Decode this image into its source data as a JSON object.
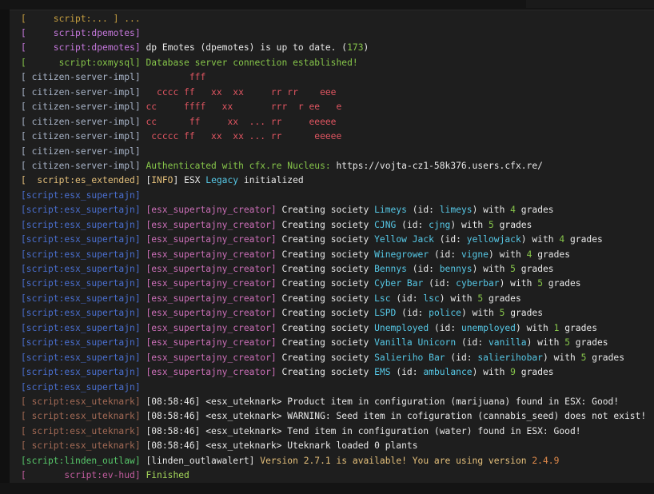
{
  "top_partial": "[     script:... ] ...",
  "colors": {
    "background": "#1e1e1e",
    "green": "#86c54a",
    "cyan": "#56c8e6",
    "red": "#e05561",
    "yellow": "#e5c07b",
    "blue": "#4a6fd0"
  },
  "lines": [
    {
      "segments": [
        {
          "t": "[     script:dpemotes]",
          "c": "c-pink"
        }
      ]
    },
    {
      "segments": [
        {
          "t": "[     script:dpemotes]",
          "c": "c-pink"
        },
        {
          "t": " dp Emotes (dpemotes) is up to date. (",
          "c": "c-white"
        },
        {
          "t": "173",
          "c": "c-green"
        },
        {
          "t": ")",
          "c": "c-white"
        }
      ]
    },
    {
      "segments": [
        {
          "t": "[      script:oxmysql]",
          "c": "c-green"
        },
        {
          "t": " Database server connection established!",
          "c": "c-green"
        }
      ]
    },
    {
      "segments": [
        {
          "t": "[ citizen-server-impl]",
          "c": "c-lightgray"
        },
        {
          "t": "         fff",
          "c": "c-red"
        }
      ]
    },
    {
      "segments": [
        {
          "t": "[ citizen-server-impl]",
          "c": "c-lightgray"
        },
        {
          "t": "   cccc ff   xx  xx     rr rr    eee",
          "c": "c-red"
        }
      ]
    },
    {
      "segments": [
        {
          "t": "[ citizen-server-impl]",
          "c": "c-lightgray"
        },
        {
          "t": " cc     ffff   xx       rrr  r ee   e",
          "c": "c-red"
        }
      ]
    },
    {
      "segments": [
        {
          "t": "[ citizen-server-impl]",
          "c": "c-lightgray"
        },
        {
          "t": " cc      ff     xx  ... rr     eeeee",
          "c": "c-red"
        }
      ]
    },
    {
      "segments": [
        {
          "t": "[ citizen-server-impl]",
          "c": "c-lightgray"
        },
        {
          "t": "  ccccc ff   xx  xx ... rr      eeeee",
          "c": "c-red"
        }
      ]
    },
    {
      "segments": [
        {
          "t": "[ citizen-server-impl]",
          "c": "c-lightgray"
        }
      ]
    },
    {
      "segments": [
        {
          "t": "[ citizen-server-impl]",
          "c": "c-lightgray"
        },
        {
          "t": " Authenticated with cfx.re Nucleus: ",
          "c": "c-green"
        },
        {
          "t": "https://vojta-cz1-58k376.users.cfx.re/",
          "c": "c-white"
        }
      ]
    },
    {
      "segments": [
        {
          "t": "[  script:es_extended]",
          "c": "c-yellow"
        },
        {
          "t": " [",
          "c": "c-white"
        },
        {
          "t": "INFO",
          "c": "c-yellow"
        },
        {
          "t": "] ESX ",
          "c": "c-white"
        },
        {
          "t": "Legacy",
          "c": "c-cyan"
        },
        {
          "t": " initialized",
          "c": "c-white"
        }
      ]
    },
    {
      "segments": [
        {
          "t": "[script:esx_supertajn]",
          "c": "c-blue"
        }
      ]
    },
    {
      "segments": [
        {
          "t": "[script:esx_supertajn]",
          "c": "c-blue"
        },
        {
          "t": " [esx_supertajny_creator]",
          "c": "c-magenta"
        },
        {
          "t": " Creating society ",
          "c": "c-white"
        },
        {
          "t": "Limeys",
          "c": "c-cyan"
        },
        {
          "t": " (id: ",
          "c": "c-white"
        },
        {
          "t": "limeys",
          "c": "c-cyan"
        },
        {
          "t": ") with ",
          "c": "c-white"
        },
        {
          "t": "4",
          "c": "c-green"
        },
        {
          "t": " grades",
          "c": "c-white"
        }
      ]
    },
    {
      "segments": [
        {
          "t": "[script:esx_supertajn]",
          "c": "c-blue"
        },
        {
          "t": " [esx_supertajny_creator]",
          "c": "c-magenta"
        },
        {
          "t": " Creating society ",
          "c": "c-white"
        },
        {
          "t": "CJNG",
          "c": "c-cyan"
        },
        {
          "t": " (id: ",
          "c": "c-white"
        },
        {
          "t": "cjng",
          "c": "c-cyan"
        },
        {
          "t": ") with ",
          "c": "c-white"
        },
        {
          "t": "5",
          "c": "c-green"
        },
        {
          "t": " grades",
          "c": "c-white"
        }
      ]
    },
    {
      "segments": [
        {
          "t": "[script:esx_supertajn]",
          "c": "c-blue"
        },
        {
          "t": " [esx_supertajny_creator]",
          "c": "c-magenta"
        },
        {
          "t": " Creating society ",
          "c": "c-white"
        },
        {
          "t": "Yellow Jack",
          "c": "c-cyan"
        },
        {
          "t": " (id: ",
          "c": "c-white"
        },
        {
          "t": "yellowjack",
          "c": "c-cyan"
        },
        {
          "t": ") with ",
          "c": "c-white"
        },
        {
          "t": "4",
          "c": "c-green"
        },
        {
          "t": " grades",
          "c": "c-white"
        }
      ]
    },
    {
      "segments": [
        {
          "t": "[script:esx_supertajn]",
          "c": "c-blue"
        },
        {
          "t": " [esx_supertajny_creator]",
          "c": "c-magenta"
        },
        {
          "t": " Creating society ",
          "c": "c-white"
        },
        {
          "t": "Winegrower",
          "c": "c-cyan"
        },
        {
          "t": " (id: ",
          "c": "c-white"
        },
        {
          "t": "vigne",
          "c": "c-cyan"
        },
        {
          "t": ") with ",
          "c": "c-white"
        },
        {
          "t": "4",
          "c": "c-green"
        },
        {
          "t": " grades",
          "c": "c-white"
        }
      ]
    },
    {
      "segments": [
        {
          "t": "[script:esx_supertajn]",
          "c": "c-blue"
        },
        {
          "t": " [esx_supertajny_creator]",
          "c": "c-magenta"
        },
        {
          "t": " Creating society ",
          "c": "c-white"
        },
        {
          "t": "Bennys",
          "c": "c-cyan"
        },
        {
          "t": " (id: ",
          "c": "c-white"
        },
        {
          "t": "bennys",
          "c": "c-cyan"
        },
        {
          "t": ") with ",
          "c": "c-white"
        },
        {
          "t": "5",
          "c": "c-green"
        },
        {
          "t": " grades",
          "c": "c-white"
        }
      ]
    },
    {
      "segments": [
        {
          "t": "[script:esx_supertajn]",
          "c": "c-blue"
        },
        {
          "t": " [esx_supertajny_creator]",
          "c": "c-magenta"
        },
        {
          "t": " Creating society ",
          "c": "c-white"
        },
        {
          "t": "Cyber Bar",
          "c": "c-cyan"
        },
        {
          "t": " (id: ",
          "c": "c-white"
        },
        {
          "t": "cyberbar",
          "c": "c-cyan"
        },
        {
          "t": ") with ",
          "c": "c-white"
        },
        {
          "t": "5",
          "c": "c-green"
        },
        {
          "t": " grades",
          "c": "c-white"
        }
      ]
    },
    {
      "segments": [
        {
          "t": "[script:esx_supertajn]",
          "c": "c-blue"
        },
        {
          "t": " [esx_supertajny_creator]",
          "c": "c-magenta"
        },
        {
          "t": " Creating society ",
          "c": "c-white"
        },
        {
          "t": "Lsc",
          "c": "c-cyan"
        },
        {
          "t": " (id: ",
          "c": "c-white"
        },
        {
          "t": "lsc",
          "c": "c-cyan"
        },
        {
          "t": ") with ",
          "c": "c-white"
        },
        {
          "t": "5",
          "c": "c-green"
        },
        {
          "t": " grades",
          "c": "c-white"
        }
      ]
    },
    {
      "segments": [
        {
          "t": "[script:esx_supertajn]",
          "c": "c-blue"
        },
        {
          "t": " [esx_supertajny_creator]",
          "c": "c-magenta"
        },
        {
          "t": " Creating society ",
          "c": "c-white"
        },
        {
          "t": "LSPD",
          "c": "c-cyan"
        },
        {
          "t": " (id: ",
          "c": "c-white"
        },
        {
          "t": "police",
          "c": "c-cyan"
        },
        {
          "t": ") with ",
          "c": "c-white"
        },
        {
          "t": "5",
          "c": "c-green"
        },
        {
          "t": " grades",
          "c": "c-white"
        }
      ]
    },
    {
      "segments": [
        {
          "t": "[script:esx_supertajn]",
          "c": "c-blue"
        },
        {
          "t": " [esx_supertajny_creator]",
          "c": "c-magenta"
        },
        {
          "t": " Creating society ",
          "c": "c-white"
        },
        {
          "t": "Unemployed",
          "c": "c-cyan"
        },
        {
          "t": " (id: ",
          "c": "c-white"
        },
        {
          "t": "unemployed",
          "c": "c-cyan"
        },
        {
          "t": ") with ",
          "c": "c-white"
        },
        {
          "t": "1",
          "c": "c-green"
        },
        {
          "t": " grades",
          "c": "c-white"
        }
      ]
    },
    {
      "segments": [
        {
          "t": "[script:esx_supertajn]",
          "c": "c-blue"
        },
        {
          "t": " [esx_supertajny_creator]",
          "c": "c-magenta"
        },
        {
          "t": " Creating society ",
          "c": "c-white"
        },
        {
          "t": "Vanilla Unicorn",
          "c": "c-cyan"
        },
        {
          "t": " (id: ",
          "c": "c-white"
        },
        {
          "t": "vanilla",
          "c": "c-cyan"
        },
        {
          "t": ") with ",
          "c": "c-white"
        },
        {
          "t": "5",
          "c": "c-green"
        },
        {
          "t": " grades",
          "c": "c-white"
        }
      ]
    },
    {
      "segments": [
        {
          "t": "[script:esx_supertajn]",
          "c": "c-blue"
        },
        {
          "t": " [esx_supertajny_creator]",
          "c": "c-magenta"
        },
        {
          "t": " Creating society ",
          "c": "c-white"
        },
        {
          "t": "Salieriho Bar",
          "c": "c-cyan"
        },
        {
          "t": " (id: ",
          "c": "c-white"
        },
        {
          "t": "salierihobar",
          "c": "c-cyan"
        },
        {
          "t": ") with ",
          "c": "c-white"
        },
        {
          "t": "5",
          "c": "c-green"
        },
        {
          "t": " grades",
          "c": "c-white"
        }
      ]
    },
    {
      "segments": [
        {
          "t": "[script:esx_supertajn]",
          "c": "c-blue"
        },
        {
          "t": " [esx_supertajny_creator]",
          "c": "c-magenta"
        },
        {
          "t": " Creating society ",
          "c": "c-white"
        },
        {
          "t": "EMS",
          "c": "c-cyan"
        },
        {
          "t": " (id: ",
          "c": "c-white"
        },
        {
          "t": "ambulance",
          "c": "c-cyan"
        },
        {
          "t": ") with ",
          "c": "c-white"
        },
        {
          "t": "9",
          "c": "c-green"
        },
        {
          "t": " grades",
          "c": "c-white"
        }
      ]
    },
    {
      "segments": [
        {
          "t": "[script:esx_supertajn]",
          "c": "c-blue"
        }
      ]
    },
    {
      "segments": [
        {
          "t": "[ script:esx_uteknark]",
          "c": "c-brown"
        },
        {
          "t": " [08:58:46] <esx_uteknark> Product item in configuration (marijuana) found in ESX: Good!",
          "c": "c-white"
        }
      ]
    },
    {
      "segments": [
        {
          "t": "[ script:esx_uteknark]",
          "c": "c-brown"
        },
        {
          "t": " [08:58:46] <esx_uteknark> WARNING: Seed item in cofiguration (cannabis_seed) does not exist!",
          "c": "c-white"
        }
      ]
    },
    {
      "segments": [
        {
          "t": "[ script:esx_uteknark]",
          "c": "c-brown"
        },
        {
          "t": " [08:58:46] <esx_uteknark> Tend item in configuration (water) found in ESX: Good!",
          "c": "c-white"
        }
      ]
    },
    {
      "segments": [
        {
          "t": "[ script:esx_uteknark]",
          "c": "c-brown"
        },
        {
          "t": " [08:58:46] <esx_uteknark> Uteknark loaded 0 plants",
          "c": "c-white"
        }
      ]
    },
    {
      "segments": [
        {
          "t": "[script:linden_outlaw]",
          "c": "c-linden"
        },
        {
          "t": " [linden_outlawalert] ",
          "c": "c-white"
        },
        {
          "t": "Version 2.7.1 is available! You are using version ",
          "c": "c-yellow"
        },
        {
          "t": "2.4.9",
          "c": "c-orange"
        }
      ]
    },
    {
      "segments": [
        {
          "t": "[       script:ev-hud]",
          "c": "c-evhud"
        },
        {
          "t": " Finished",
          "c": "c-lime"
        }
      ]
    }
  ]
}
